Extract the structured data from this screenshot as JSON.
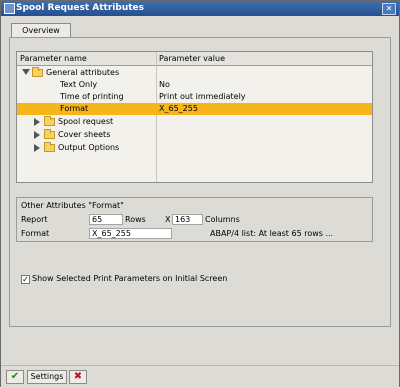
{
  "window": {
    "title": "Spool Request Attributes"
  },
  "tabs": [
    {
      "label": "Overview"
    }
  ],
  "tree": {
    "headers": {
      "name": "Parameter name",
      "value": "Parameter value"
    },
    "group_general": "General attributes",
    "rows": [
      {
        "name": "Text Only",
        "value": "No"
      },
      {
        "name": "Time of printing",
        "value": "Print out immediately"
      },
      {
        "name": "Format",
        "value": "X_65_255"
      }
    ],
    "folders": [
      "Spool request",
      "Cover sheets",
      "Output Options"
    ]
  },
  "other_attributes": {
    "title": "Other Attributes \"Format\"",
    "report_label": "Report",
    "rows_value": "65",
    "rows_label": "Rows",
    "x_label": "X",
    "columns_value": "163",
    "columns_label": "Columns",
    "format_label": "Format",
    "format_value": "X_65_255",
    "format_description": "ABAP/4 list: At least 65 rows ..."
  },
  "checkbox": {
    "label": "Show Selected Print Parameters on Initial Screen",
    "checked": true
  },
  "footer": {
    "settings_label": "Settings"
  },
  "icons": {
    "ok": "green-check-icon",
    "cancel": "red-x-icon"
  },
  "colors": {
    "titlebar": "#2c5aa0",
    "selection": "#f6b51a"
  }
}
